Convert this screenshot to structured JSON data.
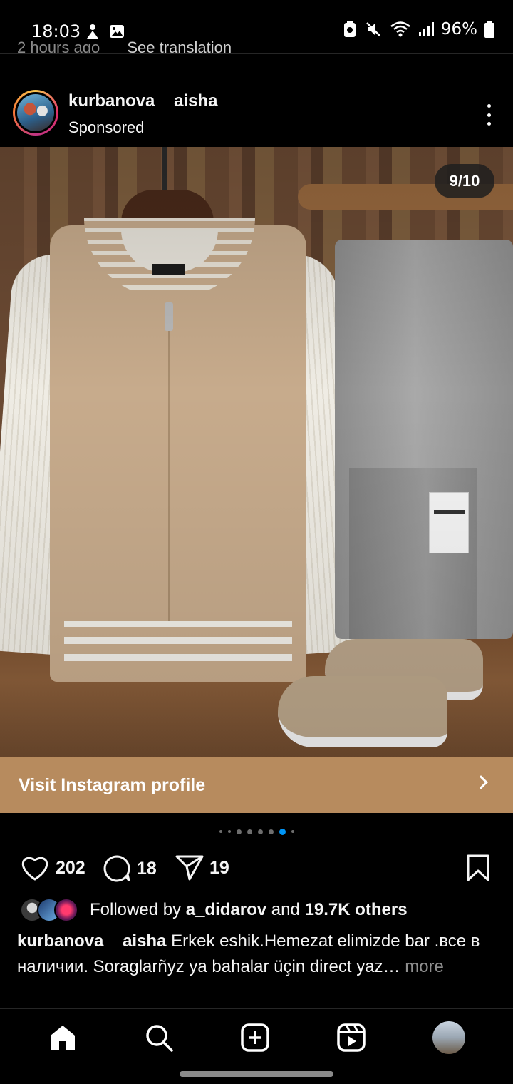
{
  "status_bar": {
    "time": "18:03",
    "battery": "96%",
    "icons": [
      "notification-icon",
      "image-icon",
      "battery-saver-icon",
      "mute-icon",
      "wifi-icon",
      "signal-icon",
      "battery-icon"
    ]
  },
  "previous_post": {
    "time_ago": "2 hours ago",
    "translate_link": "See translation"
  },
  "post": {
    "username": "kurbanova__aisha",
    "subtitle": "Sponsored",
    "carousel_counter": "9/10",
    "cta_label": "Visit Instagram profile",
    "cta_color": "#b78b5e",
    "likes": "202",
    "comments": "18",
    "shares": "19",
    "followed_by_prefix": "Followed by",
    "followed_by_user": "a_didarov",
    "followed_by_and": "and",
    "followed_by_others": "19.7K others",
    "caption_user": "kurbanova__aisha",
    "caption_text": "Erkek eshik.Hemezat elimizde bar .все в наличии. Soraglarñyz ya bahalar üçin direct yaz…",
    "caption_more": "more",
    "carousel_total": 10,
    "carousel_active": 9
  },
  "bottom_nav": [
    "home-icon",
    "search-icon",
    "create-icon",
    "reels-icon",
    "profile-avatar"
  ]
}
